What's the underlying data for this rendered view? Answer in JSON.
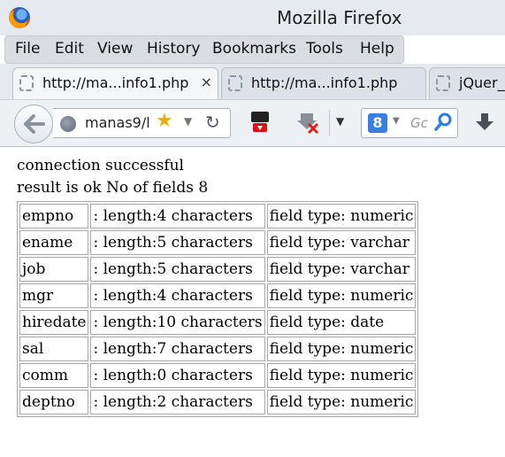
{
  "window": {
    "title": "Mozilla Firefox"
  },
  "menubar": {
    "items": [
      "File",
      "Edit",
      "View",
      "History",
      "Bookmarks",
      "Tools",
      "Help"
    ]
  },
  "tabs": [
    {
      "title": "http://ma...info1.php",
      "close": "×"
    },
    {
      "title": "http://ma...info1.php"
    },
    {
      "title": "jQuer_"
    }
  ],
  "navbar": {
    "url": "manas9/l",
    "search_placeholder": "Gc",
    "search_engine_letter": "8"
  },
  "page": {
    "line1": "connection successful",
    "line2": "result is ok No of fields 8",
    "rows": [
      {
        "name": "empno",
        "length": ": length:4 characters",
        "type": "field type: numeric"
      },
      {
        "name": "ename",
        "length": ": length:5 characters",
        "type": "field type: varchar"
      },
      {
        "name": "job",
        "length": ": length:5 characters",
        "type": "field type: varchar"
      },
      {
        "name": "mgr",
        "length": ": length:4 characters",
        "type": "field type: numeric"
      },
      {
        "name": "hiredate",
        "length": ": length:10 characters",
        "type": "field type: date"
      },
      {
        "name": "sal",
        "length": ": length:7 characters",
        "type": "field type: numeric"
      },
      {
        "name": "comm",
        "length": ": length:0 characters",
        "type": "field type: numeric"
      },
      {
        "name": "deptno",
        "length": ": length:2 characters",
        "type": "field type: numeric"
      }
    ]
  }
}
